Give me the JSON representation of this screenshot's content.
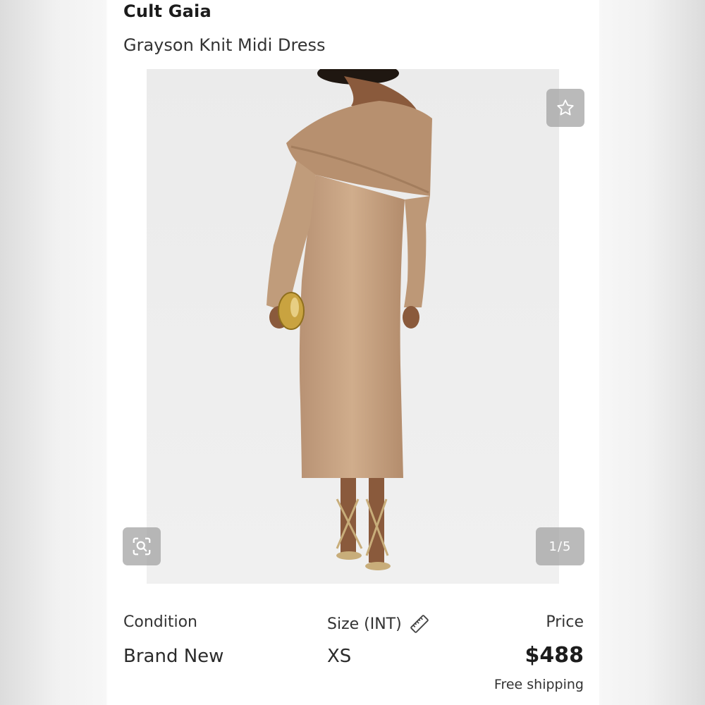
{
  "listing": {
    "brand": "Cult Gaia",
    "title": "Grayson Knit Midi Dress"
  },
  "gallery": {
    "counter": "1/5",
    "fav_icon": "star-icon",
    "zoom_icon": "zoom-search-icon"
  },
  "details": {
    "condition_label": "Condition",
    "condition_value": "Brand New",
    "size_label": "Size (INT)",
    "size_icon": "ruler-icon",
    "size_value": "XS",
    "price_label": "Price",
    "price_value": "$488",
    "shipping": "Free shipping"
  },
  "colors": {
    "overlay": "#a0a0a0",
    "dress": "#c9a584",
    "background": "#eeeeee"
  }
}
